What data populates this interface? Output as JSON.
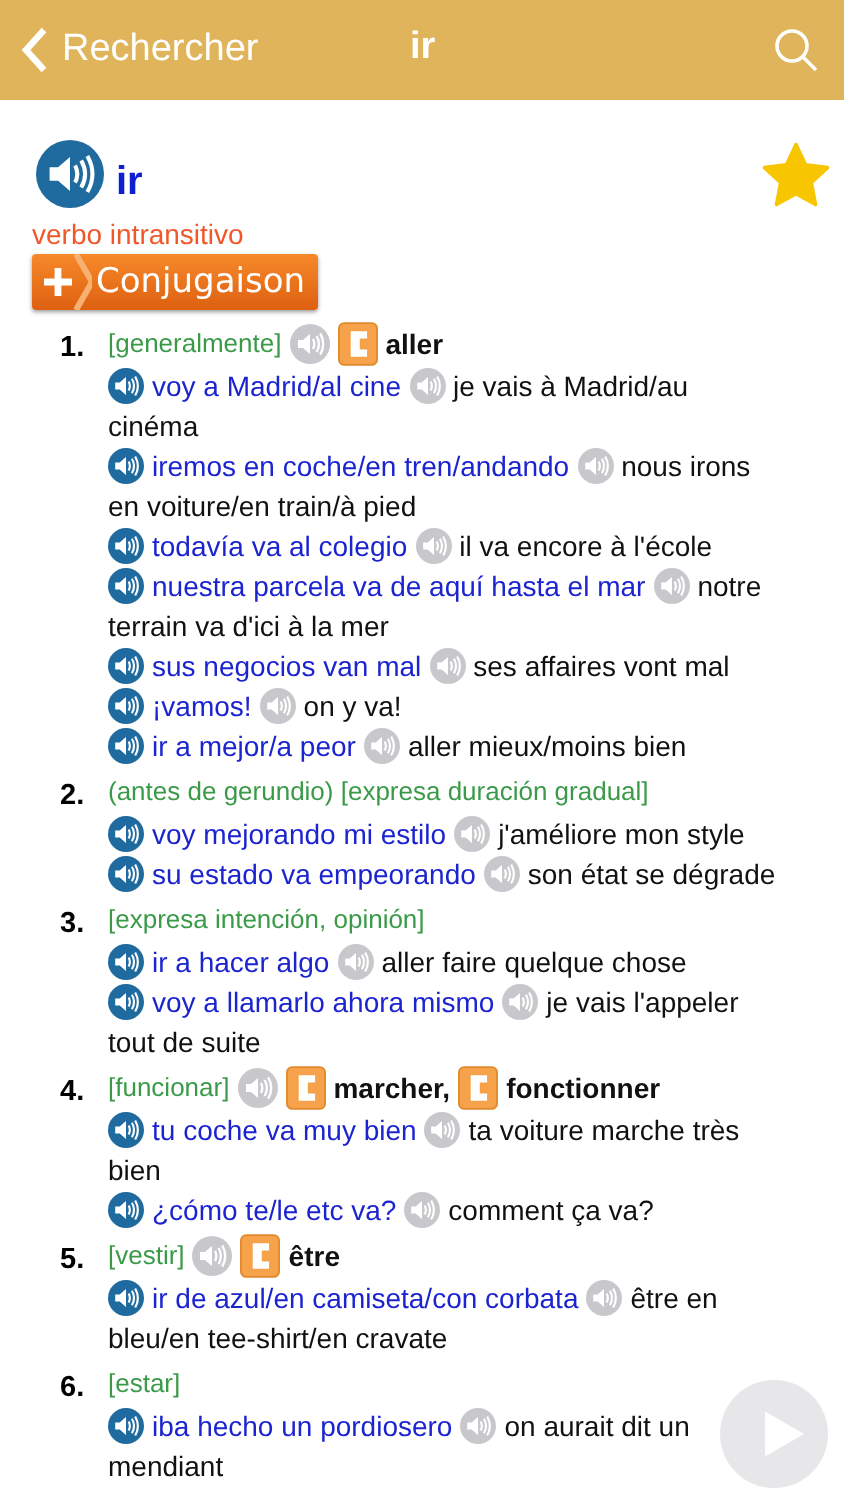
{
  "nav_bar": {
    "back_label": "Rechercher",
    "title": "ir"
  },
  "entry": {
    "headword": "ir",
    "favorite": true,
    "part_of_speech": "verbo intransitivo",
    "conjugation_button": "Conjugaison"
  },
  "senses": [
    {
      "number": "1.",
      "note": "[generalmente]",
      "translations": [
        "aller"
      ],
      "examples": [
        {
          "spanish": "voy a Madrid/al cine",
          "french_lines": [
            "je vais à Madrid/au",
            "cinéma"
          ]
        },
        {
          "spanish": "iremos en coche/en tren/andando",
          "french_lines": [
            "nous irons",
            "en voiture/en train/à pied"
          ]
        },
        {
          "spanish": "todavía va al colegio",
          "french_lines": [
            "il va encore à l'école"
          ]
        },
        {
          "spanish": "nuestra parcela va de aquí hasta el mar",
          "french_lines": [
            "notre",
            "terrain va d'ici à la mer"
          ]
        },
        {
          "spanish": "sus negocios van mal",
          "french_lines": [
            "ses affaires vont mal"
          ]
        },
        {
          "spanish": "¡vamos!",
          "french_lines": [
            "on y va!"
          ]
        },
        {
          "spanish": "ir a mejor/a peor",
          "french_lines": [
            "aller mieux/moins bien"
          ]
        }
      ]
    },
    {
      "number": "2.",
      "note": "(antes de gerundio) [expresa duración gradual]",
      "examples": [
        {
          "spanish": "voy mejorando mi estilo",
          "french_lines": [
            "j'améliore mon style"
          ]
        },
        {
          "spanish": "su estado va empeorando",
          "french_lines": [
            "son état se dégrade"
          ]
        }
      ]
    },
    {
      "number": "3.",
      "note": "[expresa intención, opinión]",
      "examples": [
        {
          "spanish": "ir a hacer algo",
          "french_lines": [
            "aller faire quelque chose"
          ]
        },
        {
          "spanish": "voy a llamarlo ahora mismo",
          "french_lines": [
            "je vais l'appeler",
            "tout de suite"
          ]
        }
      ]
    },
    {
      "number": "4.",
      "note": "[funcionar]",
      "translations": [
        "marcher,",
        "fonctionner"
      ],
      "examples": [
        {
          "spanish": "tu coche va muy bien",
          "french_lines": [
            "ta voiture marche très",
            "bien"
          ]
        },
        {
          "spanish": "¿cómo te/le etc va?",
          "french_lines": [
            "comment ça va?"
          ]
        }
      ]
    },
    {
      "number": "5.",
      "note": "[vestir]",
      "translations": [
        "être"
      ],
      "examples": [
        {
          "spanish": "ir de azul/en camiseta/con corbata",
          "french_lines": [
            "être en",
            "bleu/en tee-shirt/en cravate"
          ]
        }
      ]
    },
    {
      "number": "6.",
      "note": "[estar]",
      "examples": [
        {
          "spanish": "iba hecho un pordiosero",
          "french_lines": [
            "on aurait dit un",
            "mendiant"
          ]
        }
      ]
    }
  ]
}
